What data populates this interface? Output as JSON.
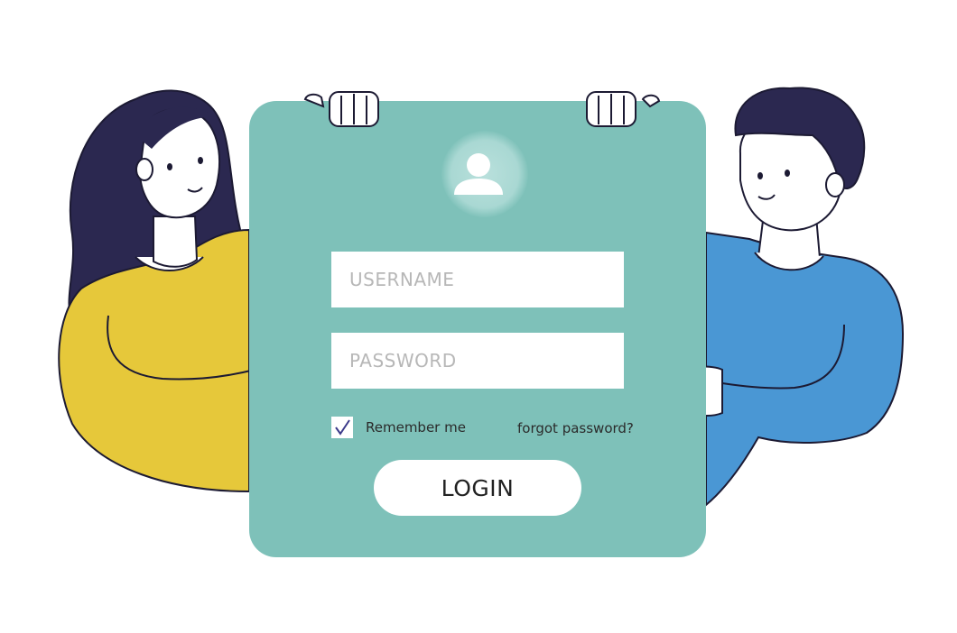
{
  "form": {
    "username_placeholder": "USERNAME",
    "password_placeholder": "PASSWORD",
    "remember_label": "Remember me",
    "remember_checked": true,
    "forgot_label": "forgot password?",
    "login_label": "LOGIN"
  },
  "colors": {
    "card": "#7ec1b9",
    "woman_shirt": "#e6c83a",
    "man_shirt": "#4a97d4",
    "hair": "#2b2850",
    "checkmark": "#3b3a8a"
  },
  "icons": {
    "avatar": "user-icon",
    "check": "checkmark-icon"
  }
}
